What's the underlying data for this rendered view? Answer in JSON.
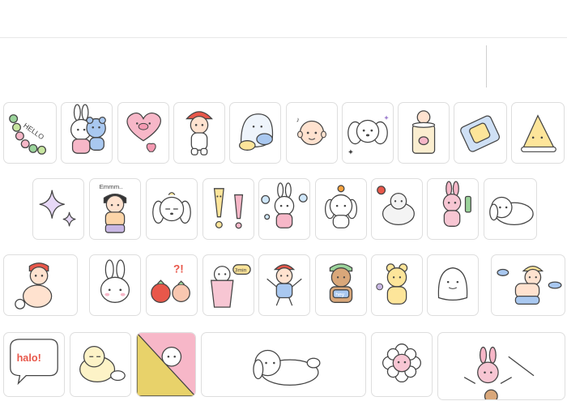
{
  "stickers": {
    "row1": [
      {
        "name": "caterpillar-hello-sticker",
        "text": "HELLO"
      },
      {
        "name": "bunny-bear-hug-sticker"
      },
      {
        "name": "pig-heart-sticker"
      },
      {
        "name": "mushroom-hat-kid-sticker"
      },
      {
        "name": "ghost-dog-snack-sticker"
      },
      {
        "name": "bald-head-sticker"
      },
      {
        "name": "fluffy-puppy-sticker"
      },
      {
        "name": "baby-in-jar-sticker"
      },
      {
        "name": "bread-bag-sticker"
      },
      {
        "name": "yellow-hat-sticker"
      }
    ],
    "row2": [
      {
        "name": "sparkle-stars-sticker"
      },
      {
        "name": "emmm-boy-sticker",
        "text": "Emmm.."
      },
      {
        "name": "sleepy-puppy-sticker"
      },
      {
        "name": "exclamation-marks-sticker"
      },
      {
        "name": "bunny-bubbles-sticker"
      },
      {
        "name": "orange-hat-puppy-sticker"
      },
      {
        "name": "tomato-bear-sticker"
      },
      {
        "name": "bunny-bottle-sticker"
      },
      {
        "name": "lying-puppy-sticker"
      }
    ],
    "row3": [
      {
        "name": "sitting-kid-sticker"
      },
      {
        "name": "bunny-face-sticker"
      },
      {
        "name": "tomato-peach-sticker",
        "text": "?!"
      },
      {
        "name": "cup-noodle-bear-sticker",
        "text": "3min"
      },
      {
        "name": "jumping-kid-sticker"
      },
      {
        "name": "hey-bear-sticker",
        "text": "hey"
      },
      {
        "name": "yellow-bear-flower-sticker"
      },
      {
        "name": "blob-ghost-sticker"
      },
      {
        "name": "swimming-kid-sticker"
      }
    ],
    "row4": [
      {
        "name": "hello-bubble-sticker",
        "text": "halo!"
      },
      {
        "name": "sleeping-puppy-sticker"
      },
      {
        "name": "peek-puppy-triangle-sticker"
      },
      {
        "name": "lazy-puppy-sticker"
      },
      {
        "name": "flower-face-sticker"
      },
      {
        "name": "bunny-tennis-sticker"
      }
    ]
  },
  "colors": {
    "border": "#dedede",
    "outline": "#444444",
    "pink": "#f7b7c8",
    "yellow": "#fde59a",
    "blue": "#a9c8f0",
    "red": "#e8574a",
    "green": "#9bd49b"
  }
}
